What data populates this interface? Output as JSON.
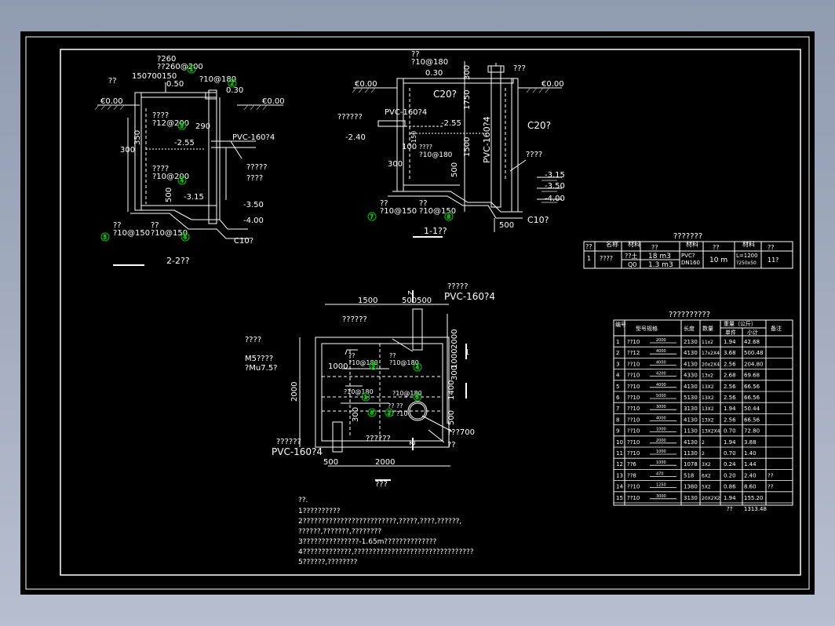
{
  "section_22": {
    "labels": {
      "dia": "?260",
      "dia2": "??260@200",
      "top1": "150700150",
      "wall": "??",
      "n050": "0.50",
      "rebar_top": "?10@180",
      "n030": "0.30",
      "e0l": "€0.00",
      "e0r": "€0.00",
      "spec1a": "????",
      "spec1b": "?12@200",
      "v350": "350",
      "v290": "290",
      "v300": "300",
      "v500": "500",
      "lv255": "-2.55",
      "pvc": "PVC-160?4",
      "pipe1": "?????",
      "pipe2": "????",
      "spec2a": "????",
      "spec2b": "?10@200",
      "lv315": "-3.15",
      "lv350": "-3.50",
      "lv400": "-4.00",
      "bot1a": "??",
      "bot1b": "?10@150",
      "bot2a": "??",
      "bot2b": "?10@150",
      "c10": "C10?",
      "title": "2-2??"
    },
    "markers": [
      "1",
      "2",
      "3",
      "4",
      "5",
      "6"
    ]
  },
  "section_11": {
    "labels": {
      "dia": "??",
      "rebar": "?10@180",
      "n030": "0.30",
      "v300": "300",
      "pipe": "???",
      "e0l": "€0.00",
      "e0r": "€0.00",
      "c20a": "C20?",
      "v1750": "1750",
      "pvcl": "PVC-160?4",
      "desc": "??????",
      "lv240": "-2.40",
      "lv255": "-2.55",
      "v150": "150",
      "v1500": "1500",
      "v100": "100",
      "spec1": "????",
      "spec2": "?10@180",
      "v300b": "300",
      "v500": "500",
      "pvcv": "PVC-160?4",
      "c20b": "C20?",
      "q4": "????",
      "lv315": "-3.15",
      "lv350": "-3.50",
      "lv400": "-4.00",
      "bl1": "??",
      "bl2": "?10@150",
      "br1": "??",
      "br2": "?10@150",
      "c10": "C10?",
      "v500b": "500",
      "title": "1-1??"
    },
    "markers": [
      "7",
      "8"
    ]
  },
  "plan": {
    "labels": {
      "q5": "?????",
      "pvc_top": "PVC-160?4",
      "d1500": "1500",
      "d500500": "500500",
      "n6": "??????",
      "d2000v": "2000",
      "d1000v": "1000",
      "d300v": "300",
      "d1400": "1400",
      "d500v": "500",
      "ann1": "????",
      "m5": "M5????",
      "mu": "?Mu7.5?",
      "d1000": "1000",
      "s1a": "??",
      "s1b": "?10@180",
      "s2a": "??",
      "s2b": "?10@180",
      "s3": "?10@180",
      "s4": "?10@180",
      "s5": "?? ??",
      "s6": "?? ?10",
      "d700": "???700",
      "q2": "??",
      "n6b": "??????",
      "n6c": "??????",
      "pvc_bot": "PVC-160?4",
      "d500h": "500",
      "d2000h": "2000",
      "sec1": "1",
      "sec2": "2",
      "title": "???"
    },
    "markers": [
      "3",
      "4",
      "1",
      "5",
      "6",
      "2"
    ]
  },
  "notes": {
    "title": "??.",
    "lines": [
      "1??????????",
      "2?????????????????????????,?????,????,??????,",
      "  ??????,???????,????????",
      "3???????????????-1.65m??????????????",
      "4?????????????,????????????????????????????????",
      "5??????,????????"
    ]
  },
  "material_table": {
    "title": "???????",
    "headers": [
      "??",
      "名称",
      "材料",
      "??",
      "材料",
      "??",
      "材料",
      "??"
    ],
    "row": {
      "no": "1",
      "name": "????",
      "mat1a": "??土",
      "qty1a": "18 m3",
      "mat1b": "Q0",
      "qty1b": "1.3 m3",
      "pipe_a": "PVC?",
      "pipe_b": "DN160",
      "len": "10 m",
      "cover_a": "L=1200",
      "cover_b": "?250x50",
      "count": "11?"
    }
  },
  "rebar_table": {
    "title": "??????????",
    "headers": [
      "编号",
      "型号规格",
      "长度",
      "数量",
      "单件",
      "小计",
      "备注"
    ],
    "weight_header": "重量（公斤）",
    "rows": [
      {
        "no": "1",
        "type": "??10",
        "shape": "2000",
        "len": "2130",
        "qty": "11x2",
        "unit": "1.94",
        "sub": "42.68",
        "note": ""
      },
      {
        "no": "2",
        "type": "??12",
        "shape": "4000",
        "len": "4130",
        "qty": "17x2X4",
        "unit": "3.68",
        "sub": "500.48",
        "note": ""
      },
      {
        "no": "3",
        "type": "??10",
        "shape": "4000",
        "len": "4130",
        "qty": "20x2X4",
        "unit": "2.56",
        "sub": "204.80",
        "note": ""
      },
      {
        "no": "4",
        "type": "??10",
        "shape": "4200",
        "len": "4330",
        "qty": "13x2",
        "unit": "2.68",
        "sub": "69.68",
        "note": ""
      },
      {
        "no": "5",
        "type": "??10",
        "shape": "4000",
        "len": "4130",
        "qty": "13X2",
        "unit": "2.56",
        "sub": "66.56",
        "note": ""
      },
      {
        "no": "6",
        "type": "??10",
        "shape": "5000",
        "len": "5130",
        "qty": "13X2",
        "unit": "2.56",
        "sub": "66.56",
        "note": ""
      },
      {
        "no": "7",
        "type": "??10",
        "shape": "3000",
        "len": "3130",
        "qty": "13X2",
        "unit": "1.94",
        "sub": "50.44",
        "note": ""
      },
      {
        "no": "8",
        "type": "??10",
        "shape": "4000",
        "len": "4130",
        "qty": "13X2",
        "unit": "2.56",
        "sub": "66.56",
        "note": ""
      },
      {
        "no": "9",
        "type": "??10",
        "shape": "1000",
        "len": "1130",
        "qty": "13X2X4",
        "unit": "0.70",
        "sub": "72.80",
        "note": ""
      },
      {
        "no": "10",
        "type": "??10",
        "shape": "2000",
        "len": "4130",
        "qty": "2",
        "unit": "1.94",
        "sub": "3.88",
        "note": ""
      },
      {
        "no": "11",
        "type": "??10",
        "shape": "1000",
        "len": "1130",
        "qty": "2",
        "unit": "0.70",
        "sub": "1.40",
        "note": ""
      },
      {
        "no": "12",
        "type": "??6",
        "shape": "1000",
        "len": "1078",
        "qty": "3X2",
        "unit": "0.24",
        "sub": "1.44",
        "note": ""
      },
      {
        "no": "13",
        "type": "??8",
        "shape": "470",
        "len": "518",
        "qty": "6X2",
        "unit": "0.20",
        "sub": "2.40",
        "note": "??"
      },
      {
        "no": "14",
        "type": "??10",
        "shape": "1250",
        "len": "1380",
        "qty": "5X2",
        "unit": "0.86",
        "sub": "8.60",
        "note": "??"
      },
      {
        "no": "15",
        "type": "??10",
        "shape": "3000",
        "len": "3130",
        "qty": "20X2X2",
        "unit": "1.94",
        "sub": "155.20",
        "note": ""
      }
    ],
    "total_label": "??",
    "total": "1313.48"
  },
  "colors": {
    "line": "#ffffff",
    "marker": "#00c800",
    "ground": "#cfcfcf"
  }
}
